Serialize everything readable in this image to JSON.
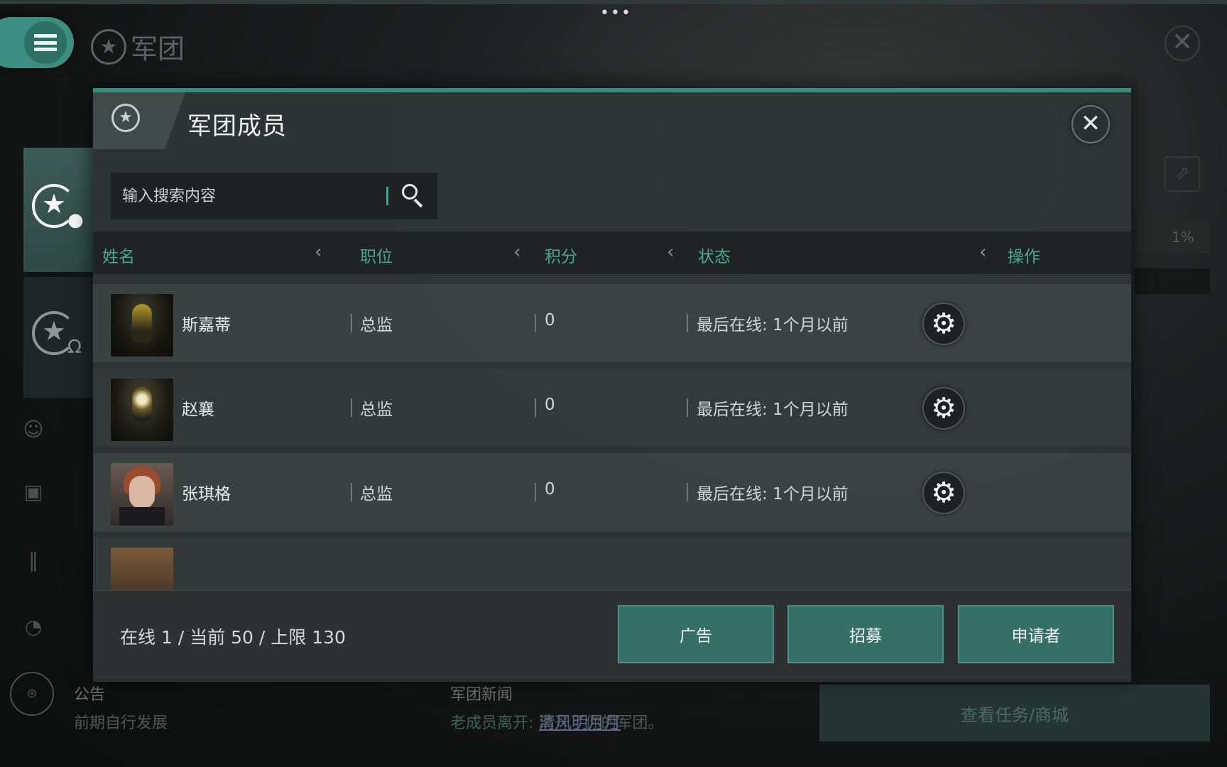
{
  "background": {
    "title": "军团",
    "more_icon": "more-dots-icon",
    "announcement_label": "公告",
    "announcement_text": "前期自行发展",
    "news_label": "军团新闻",
    "news_prefix": "老成员离开:",
    "news_name": "清风明月月",
    "news_suffix": "离开了你的军团。",
    "progress": "1%",
    "tasks_button": "查看任务/商城"
  },
  "dialog": {
    "title": "军团成员",
    "close_icon": "close-icon",
    "search": {
      "placeholder": "输入搜索内容",
      "value": ""
    },
    "columns": {
      "name": "姓名",
      "role": "职位",
      "points": "积分",
      "status": "状态",
      "action": "操作"
    },
    "members": [
      {
        "name": "斯嘉蒂",
        "role": "总监",
        "points": "0",
        "status": "最后在线: 1个月以前"
      },
      {
        "name": "赵襄",
        "role": "总监",
        "points": "0",
        "status": "最后在线: 1个月以前"
      },
      {
        "name": "张琪格",
        "role": "总监",
        "points": "0",
        "status": "最后在线: 1个月以前"
      }
    ],
    "stats": "在线 1 / 当前 50 / 上限 130",
    "buttons": {
      "ads": "广告",
      "recruit": "招募",
      "applicants": "申请者"
    }
  },
  "colors": {
    "accent": "#3b8b7d",
    "header_text": "#4ba792",
    "button": "#356f66"
  }
}
